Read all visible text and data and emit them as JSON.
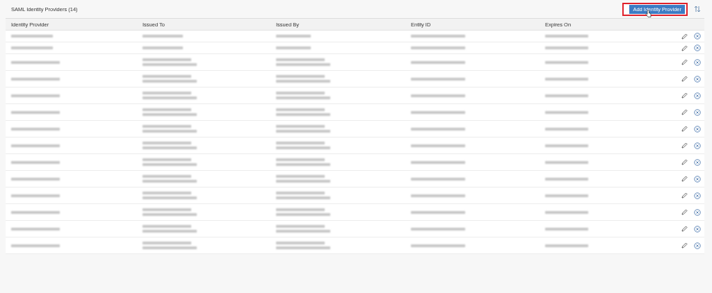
{
  "panel": {
    "title": "SAML Identity Providers (14)",
    "add_button": "Add Identity Provider"
  },
  "table": {
    "columns": [
      "Identity Provider",
      "Issued To",
      "Issued By",
      "Entity ID",
      "Expires On"
    ],
    "rows": [
      {
        "kind": "single"
      },
      {
        "kind": "single"
      },
      {
        "kind": "double"
      },
      {
        "kind": "double"
      },
      {
        "kind": "double"
      },
      {
        "kind": "double"
      },
      {
        "kind": "double"
      },
      {
        "kind": "double"
      },
      {
        "kind": "double"
      },
      {
        "kind": "double"
      },
      {
        "kind": "double"
      },
      {
        "kind": "double"
      },
      {
        "kind": "double"
      },
      {
        "kind": "double"
      }
    ]
  }
}
